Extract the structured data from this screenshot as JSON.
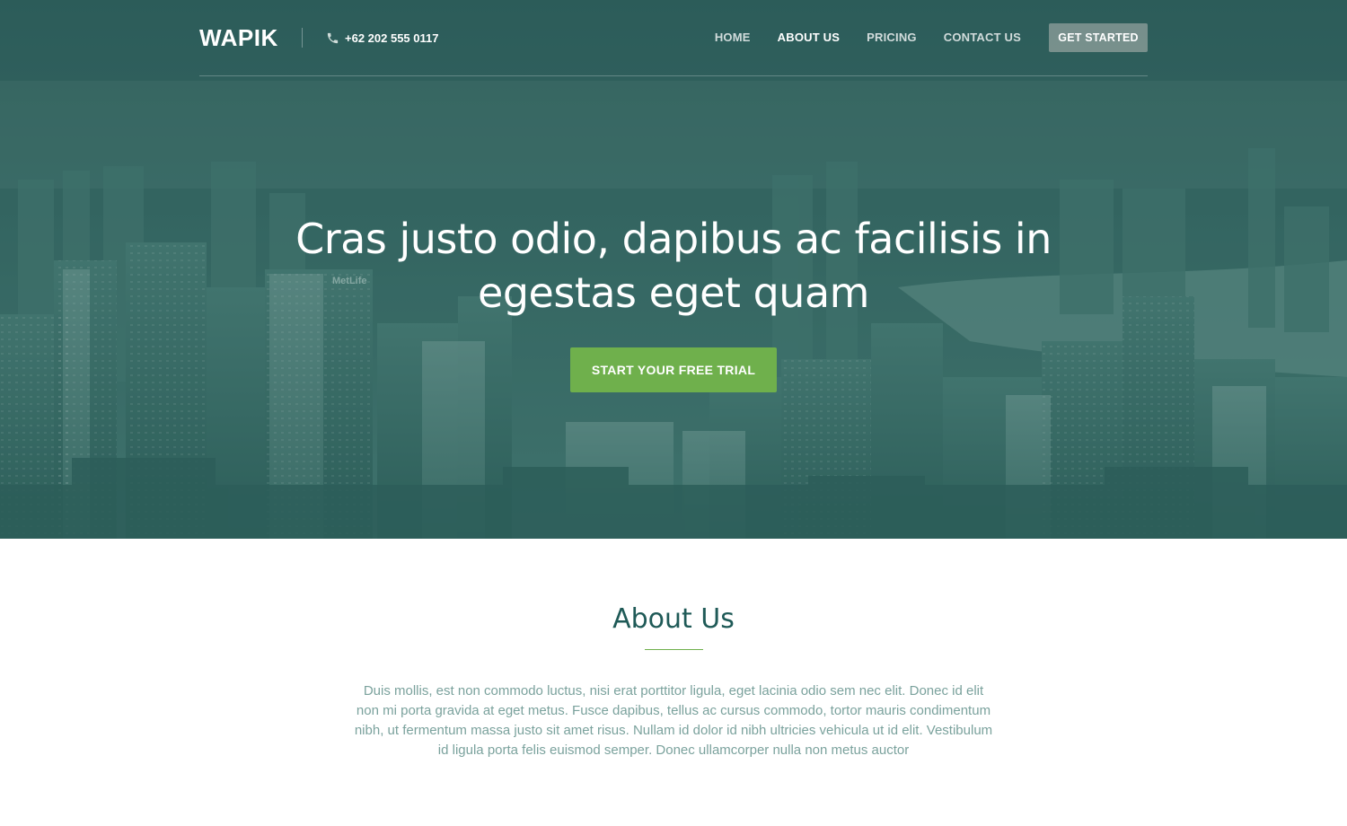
{
  "header": {
    "logo": "WAPIK",
    "phone": "+62 202 555 0117",
    "phone_icon": "phone-icon",
    "menu": [
      {
        "label": "HOME",
        "active": false
      },
      {
        "label": "ABOUT US",
        "active": true
      },
      {
        "label": "PRICING",
        "active": false
      },
      {
        "label": "CONTACT US",
        "active": false
      }
    ],
    "cta_label": "GET STARTED"
  },
  "hero": {
    "title": "Cras justo odio, dapibus ac facilisis in egestas eget quam",
    "button_label": "START YOUR FREE TRIAL",
    "building_sign": "MetLife"
  },
  "about": {
    "title": "About Us",
    "body": "Duis mollis, est non commodo luctus, nisi erat porttitor ligula, eget lacinia odio sem nec elit. Donec id elit non mi porta gravida at eget metus. Fusce dapibus, tellus ac cursus commodo, tortor mauris condimentum nibh, ut fermentum massa justo sit amet risus. Nullam id dolor id nibh ultricies vehicula ut id elit. Vestibulum id ligula porta felis euismod semper. Donec ullamcorper nulla non metus auctor"
  },
  "colors": {
    "accent_green": "#6fb04c",
    "hero_teal": "#3b6d69",
    "heading_teal": "#1f5a57",
    "body_text": "#7ba29d"
  }
}
